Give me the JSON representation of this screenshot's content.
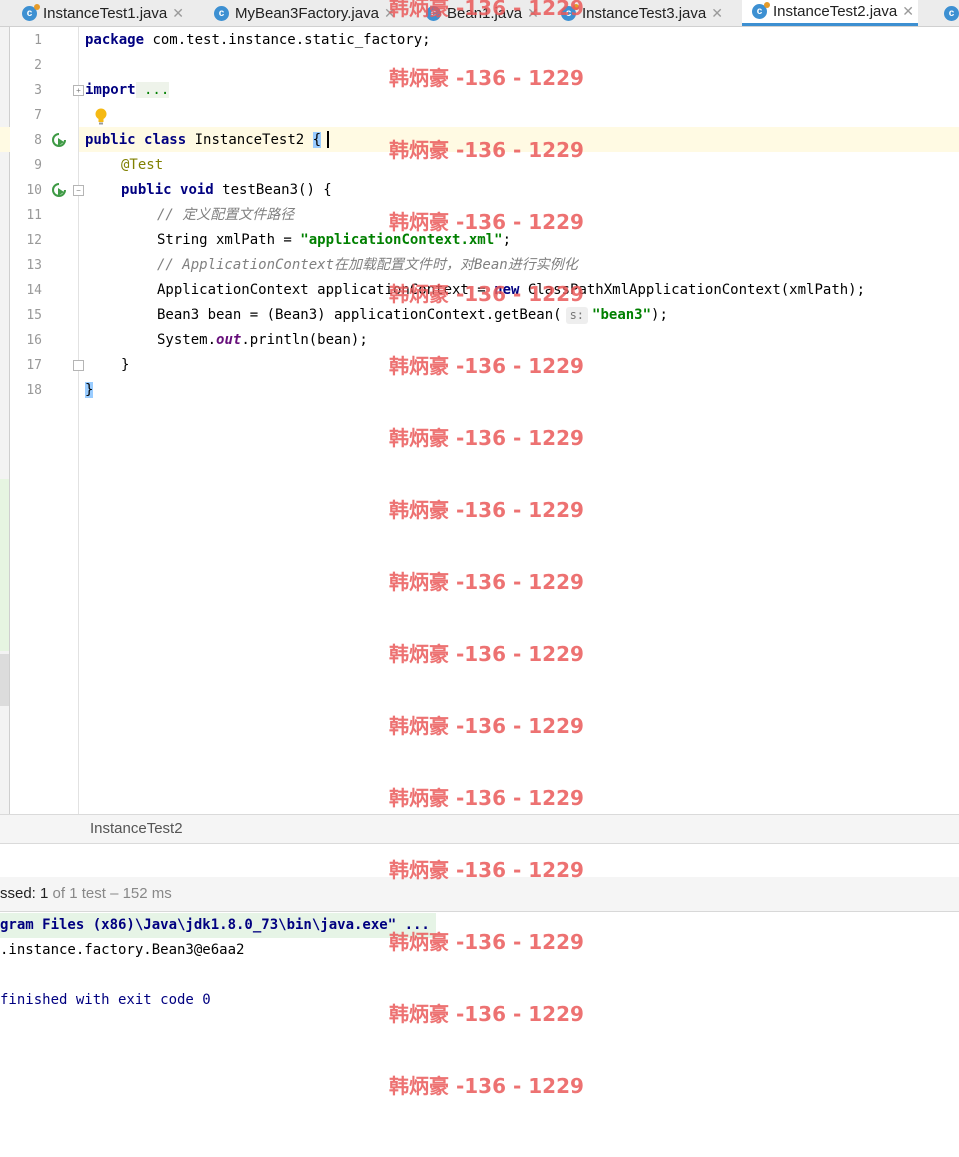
{
  "tabs": [
    {
      "label": "InstanceTest1.java",
      "icon": "test-class-icon",
      "closable": true,
      "active": false
    },
    {
      "label": "MyBean3Factory.java",
      "icon": "class-icon",
      "closable": true,
      "active": false
    },
    {
      "label": "Bean1.java",
      "icon": "class-icon",
      "closable": true,
      "active": false
    },
    {
      "label": "InstanceTest3.java",
      "icon": "test-class-icon",
      "closable": true,
      "active": false
    },
    {
      "label": "InstanceTest2.java",
      "icon": "test-class-icon",
      "closable": true,
      "active": true
    },
    {
      "label": "",
      "icon": "class-icon",
      "closable": false,
      "active": false
    }
  ],
  "editor": {
    "line_numbers": [
      "1",
      "2",
      "3",
      "7",
      "8",
      "9",
      "10",
      "11",
      "12",
      "13",
      "14",
      "15",
      "16",
      "17",
      "18"
    ],
    "code": {
      "l1_kw": "package",
      "l1_rest": " com.test.instance.static_factory;",
      "l3_kw": "import",
      "l3_rest": " ...",
      "l8_kw1": "public",
      "l8_kw2": "class",
      "l8_name": " InstanceTest2 ",
      "l8_brace": "{",
      "l9_ann": "@Test",
      "l10_kw1": "public",
      "l10_kw2": "void",
      "l10_rest": " testBean3() {",
      "l11_cmt": "// 定义配置文件路径",
      "l12_a": "String xmlPath = ",
      "l12_str": "\"applicationContext.xml\"",
      "l12_b": ";",
      "l13_cmt": "// ApplicationContext在加载配置文件时，对Bean进行实例化",
      "l14_a": "ApplicationContext applicationContext = ",
      "l14_kw": "new",
      "l14_b": " ClassPathXmlApplicationContext(xmlPath);",
      "l15_a": "Bean3 bean = (Bean3) applicationContext.getBean(",
      "l15_hint": "s:",
      "l15_str": "\"bean3\"",
      "l15_b": ");",
      "l16_a": "System.",
      "l16_fld": "out",
      "l16_b": ".println(bean);",
      "l17": "}",
      "l18": "}"
    }
  },
  "breadcrumb": {
    "label": "InstanceTest2"
  },
  "test_status": {
    "prefix": "ssed: ",
    "count": "1",
    "rest": " of 1 test – 152 ms"
  },
  "console": {
    "cmd": "gram Files (x86)\\Java\\jdk1.8.0_73\\bin\\java.exe\" ...",
    "out": ".instance.factory.Bean3@e6aa2",
    "exit": "finished with exit code 0"
  },
  "watermark": {
    "text": "韩炳豪 -136 - 1229"
  },
  "colors": {
    "accent": "#3d8fd1",
    "keyword": "#000080",
    "string": "#008000",
    "comment": "#808080",
    "watermark": "#ea5a5a"
  }
}
